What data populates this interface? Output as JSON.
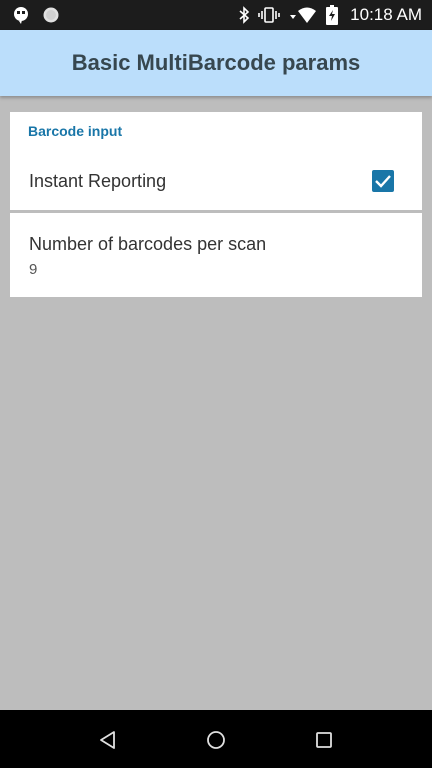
{
  "status_bar": {
    "time": "10:18 AM",
    "left_icons": [
      "hangouts-icon",
      "circle-notification-icon"
    ],
    "right_icons": [
      "bluetooth-icon",
      "vibrate-icon",
      "wifi-icon",
      "battery-charging-icon"
    ]
  },
  "app_bar": {
    "title": "Basic MultiBarcode params",
    "background": "#bbdefb"
  },
  "sections": [
    {
      "header": "Barcode input",
      "header_color": "#1976a8",
      "items": [
        {
          "title": "Instant Reporting",
          "type": "checkbox",
          "checked": true
        }
      ]
    },
    {
      "items": [
        {
          "title": "Number of barcodes per scan",
          "summary": "9",
          "type": "text"
        }
      ]
    }
  ],
  "nav_bar": {
    "buttons": [
      "back-icon",
      "home-icon",
      "recents-icon"
    ]
  },
  "colors": {
    "accent": "#1976a8",
    "background": "#bdbdbd"
  }
}
